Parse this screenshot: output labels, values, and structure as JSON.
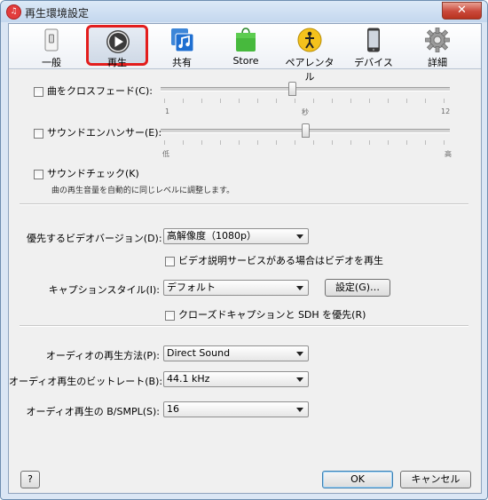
{
  "window": {
    "title": "再生環境設定",
    "close_glyph": "✕",
    "app_icon_glyph": "♫"
  },
  "toolbar": {
    "items": [
      {
        "label": "一般",
        "icon": "general-icon"
      },
      {
        "label": "再生",
        "icon": "playback-icon"
      },
      {
        "label": "共有",
        "icon": "sharing-icon"
      },
      {
        "label": "Store",
        "icon": "store-icon"
      },
      {
        "label": "ペアレンタル",
        "icon": "parental-icon"
      },
      {
        "label": "デバイス",
        "icon": "devices-icon"
      },
      {
        "label": "詳細",
        "icon": "advanced-icon"
      }
    ],
    "selected": "再生",
    "highlight_color": "#e31d1d"
  },
  "crossfade": {
    "label": "曲をクロスフェード(C):",
    "checked": false,
    "min_label": "1",
    "unit_label": "秒",
    "max_label": "12",
    "value": 6
  },
  "enhancer": {
    "label": "サウンドエンハンサー(E):",
    "checked": false,
    "low_label": "低",
    "high_label": "高",
    "level": 0.5
  },
  "soundcheck": {
    "label": "サウンドチェック(K)",
    "checked": false,
    "description": "曲の再生音量を自動的に同じレベルに調整します。"
  },
  "video": {
    "version_label": "優先するビデオバージョン(D):",
    "version_value": "高解像度（1080p）",
    "audio_desc_label": "ビデオ説明サービスがある場合はビデオを再生",
    "audio_desc_checked": false,
    "caption_label": "キャプションスタイル(I):",
    "caption_value": "デフォルト",
    "caption_settings_button": "設定(G)…",
    "cc_sdh_label": "クローズドキャプションと SDH を優先(R)",
    "cc_sdh_checked": false
  },
  "audio": {
    "playback_label": "オーディオの再生方法(P):",
    "playback_value": "Direct Sound",
    "bitrate_label": "オーディオ再生のビットレート(B):",
    "bitrate_value": "44.1 kHz",
    "bits_label": "オーディオ再生の B/SMPL(S):",
    "bits_value": "16"
  },
  "footer": {
    "help_label": "?",
    "ok_label": "OK",
    "cancel_label": "キャンセル"
  }
}
